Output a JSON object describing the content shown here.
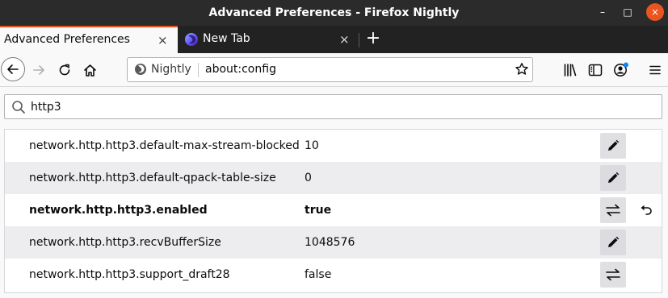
{
  "window": {
    "title": "Advanced Preferences - Firefox Nightly",
    "controls": {
      "minimize_glyph": "–",
      "maximize_glyph": "□",
      "close_glyph": "×"
    }
  },
  "tabs": [
    {
      "label": "Advanced Preferences",
      "active": true,
      "close_glyph": "×"
    },
    {
      "label": "New Tab",
      "active": false,
      "favicon": "firefox-nightly-icon",
      "close_glyph": "×"
    }
  ],
  "new_tab_glyph": "+",
  "navbar": {
    "identity_label": "Nightly",
    "url": "about:config",
    "icons": [
      "back-icon",
      "forward-icon",
      "reload-icon",
      "home-icon",
      "star-icon",
      "library-icon",
      "sidebar-icon",
      "account-icon",
      "menu-icon"
    ]
  },
  "search": {
    "value": "http3"
  },
  "preferences": [
    {
      "name": "network.http.http3.default-max-stream-blocked",
      "value": "10",
      "action": "edit",
      "modified": false
    },
    {
      "name": "network.http.http3.default-qpack-table-size",
      "value": "0",
      "action": "edit",
      "modified": false
    },
    {
      "name": "network.http.http3.enabled",
      "value": "true",
      "action": "toggle",
      "modified": true
    },
    {
      "name": "network.http.http3.recvBufferSize",
      "value": "1048576",
      "action": "edit",
      "modified": false
    },
    {
      "name": "network.http.http3.support_draft28",
      "value": "false",
      "action": "toggle",
      "modified": false
    }
  ],
  "colors": {
    "titlebar": "#2b2b2b",
    "tabstrip": "#222222",
    "accent": "#e95420",
    "row_alt": "#ededf0",
    "notification_dot": "#0a84ff"
  }
}
